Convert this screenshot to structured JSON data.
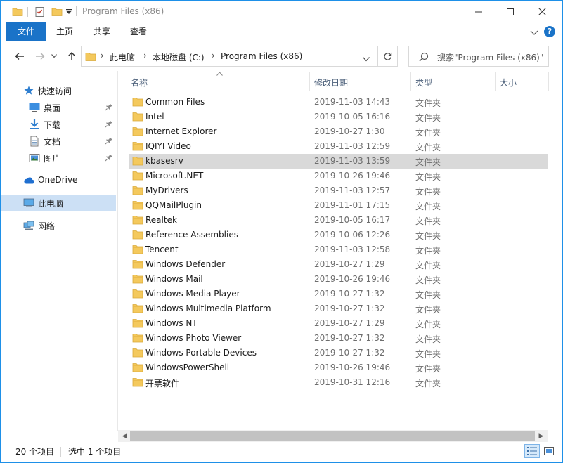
{
  "window": {
    "title": "Program Files (x86)"
  },
  "ribbon": {
    "tabs": [
      {
        "label": "文件",
        "active": true
      },
      {
        "label": "主页",
        "active": false
      },
      {
        "label": "共享",
        "active": false
      },
      {
        "label": "查看",
        "active": false
      }
    ],
    "help_label": "?"
  },
  "address": {
    "breadcrumbs": [
      "此电脑",
      "本地磁盘 (C:)",
      "Program Files (x86)"
    ]
  },
  "search": {
    "placeholder": "搜索\"Program Files (x86)\""
  },
  "nav": {
    "quick_access": "快速访问",
    "items": [
      {
        "label": "桌面",
        "icon": "desktop-icon",
        "pinned": true
      },
      {
        "label": "下载",
        "icon": "download-icon",
        "pinned": true
      },
      {
        "label": "文档",
        "icon": "documents-icon",
        "pinned": true
      },
      {
        "label": "图片",
        "icon": "pictures-icon",
        "pinned": true
      }
    ],
    "onedrive": "OneDrive",
    "this_pc": "此电脑",
    "network": "网络"
  },
  "columns": {
    "name": "名称",
    "date": "修改日期",
    "type": "类型",
    "size": "大小"
  },
  "files": [
    {
      "name": "Common Files",
      "date": "2019-11-03 14:43",
      "type": "文件夹"
    },
    {
      "name": "Intel",
      "date": "2019-10-05 16:16",
      "type": "文件夹"
    },
    {
      "name": "Internet Explorer",
      "date": "2019-10-27 1:30",
      "type": "文件夹"
    },
    {
      "name": "IQIYI Video",
      "date": "2019-11-03 12:59",
      "type": "文件夹"
    },
    {
      "name": "kbasesrv",
      "date": "2019-11-03 13:59",
      "type": "文件夹",
      "selected": true
    },
    {
      "name": "Microsoft.NET",
      "date": "2019-10-26 19:46",
      "type": "文件夹"
    },
    {
      "name": "MyDrivers",
      "date": "2019-11-03 12:57",
      "type": "文件夹"
    },
    {
      "name": "QQMailPlugin",
      "date": "2019-11-01 17:15",
      "type": "文件夹"
    },
    {
      "name": "Realtek",
      "date": "2019-10-05 16:17",
      "type": "文件夹"
    },
    {
      "name": "Reference Assemblies",
      "date": "2019-10-06 12:26",
      "type": "文件夹"
    },
    {
      "name": "Tencent",
      "date": "2019-11-03 12:58",
      "type": "文件夹"
    },
    {
      "name": "Windows Defender",
      "date": "2019-10-27 1:29",
      "type": "文件夹"
    },
    {
      "name": "Windows Mail",
      "date": "2019-10-26 19:46",
      "type": "文件夹"
    },
    {
      "name": "Windows Media Player",
      "date": "2019-10-27 1:32",
      "type": "文件夹"
    },
    {
      "name": "Windows Multimedia Platform",
      "date": "2019-10-27 1:32",
      "type": "文件夹"
    },
    {
      "name": "Windows NT",
      "date": "2019-10-27 1:29",
      "type": "文件夹"
    },
    {
      "name": "Windows Photo Viewer",
      "date": "2019-10-27 1:32",
      "type": "文件夹"
    },
    {
      "name": "Windows Portable Devices",
      "date": "2019-10-27 1:32",
      "type": "文件夹"
    },
    {
      "name": "WindowsPowerShell",
      "date": "2019-10-26 19:46",
      "type": "文件夹"
    },
    {
      "name": "开票软件",
      "date": "2019-10-31 12:16",
      "type": "文件夹"
    }
  ],
  "status": {
    "count": "20 个项目",
    "selection": "选中 1 个项目"
  },
  "colors": {
    "accent": "#1a73c8",
    "folder": "#f4c95d",
    "selected_row": "#d9d9d9",
    "nav_selected": "#cce0f5"
  }
}
